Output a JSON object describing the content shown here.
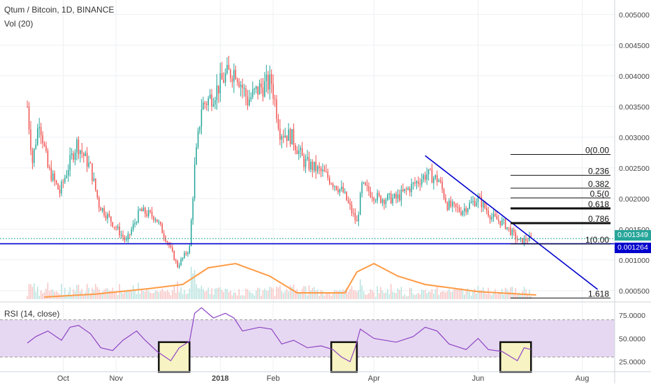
{
  "header": {
    "title": "Qtum / Bitcoin, 1D, BINANCE",
    "volume_label": "Vol (20)",
    "rsi_label": "RSI (14, close)"
  },
  "colors": {
    "up": "#26a69a",
    "down": "#ef5350",
    "line": "#0000cc",
    "volume_ma": "#ff9b45",
    "rsi": "#8e44c4",
    "rsi_band": "#e6d8f2",
    "price_tag_green": "#26a69a",
    "price_tag_blue": "#0000cc",
    "highlight_fill": "#f7f3c2"
  },
  "price_tags": {
    "current": "0.001349",
    "support": "0.001264"
  },
  "chart_data": [
    {
      "type": "candlestick",
      "title": "Qtum / Bitcoin, 1D, BINANCE",
      "x_ticks": [
        "Oct",
        "Nov",
        "2018",
        "Feb",
        "Apr",
        "Jun",
        "Aug"
      ],
      "y_ticks": [
        "0.000500",
        "0.001000",
        "0.001500",
        "0.002000",
        "0.002500",
        "0.003000",
        "0.003500",
        "0.004000",
        "0.004500",
        "0.005000"
      ],
      "ylim": [
        0.00035,
        0.0051
      ],
      "close_path": [
        [
          "2017-09-10",
          0.0035
        ],
        [
          "2017-09-13",
          0.0026
        ],
        [
          "2017-09-17",
          0.0033
        ],
        [
          "2017-09-22",
          0.0025
        ],
        [
          "2017-09-29",
          0.0021
        ],
        [
          "2017-10-05",
          0.0026
        ],
        [
          "2017-10-09",
          0.0029
        ],
        [
          "2017-10-17",
          0.0025
        ],
        [
          "2017-10-22",
          0.0019
        ],
        [
          "2017-10-30",
          0.0016
        ],
        [
          "2017-11-07",
          0.0013
        ],
        [
          "2017-11-15",
          0.0018
        ],
        [
          "2017-11-24",
          0.0017
        ],
        [
          "2017-12-01",
          0.0013
        ],
        [
          "2017-12-07",
          0.0009
        ],
        [
          "2017-12-14",
          0.0012
        ],
        [
          "2017-12-17",
          0.0025
        ],
        [
          "2017-12-21",
          0.0035
        ],
        [
          "2017-12-28",
          0.0037
        ],
        [
          "2018-01-04",
          0.004
        ],
        [
          "2018-01-10",
          0.0041
        ],
        [
          "2018-01-17",
          0.0036
        ],
        [
          "2018-01-24",
          0.0038
        ],
        [
          "2018-01-31",
          0.0039
        ],
        [
          "2018-02-05",
          0.0031
        ],
        [
          "2018-02-12",
          0.003
        ],
        [
          "2018-02-19",
          0.0026
        ],
        [
          "2018-03-03",
          0.0024
        ],
        [
          "2018-03-14",
          0.0021
        ],
        [
          "2018-03-22",
          0.0016
        ],
        [
          "2018-03-25",
          0.0022
        ],
        [
          "2018-04-04",
          0.002
        ],
        [
          "2018-04-14",
          0.002
        ],
        [
          "2018-04-23",
          0.0022
        ],
        [
          "2018-05-02",
          0.0024
        ],
        [
          "2018-05-09",
          0.0023
        ],
        [
          "2018-05-14",
          0.0019
        ],
        [
          "2018-05-22",
          0.0018
        ],
        [
          "2018-06-01",
          0.002
        ],
        [
          "2018-06-09",
          0.0017
        ],
        [
          "2018-06-16",
          0.0016
        ],
        [
          "2018-06-25",
          0.0013
        ],
        [
          "2018-07-02",
          0.00135
        ]
      ],
      "trend_line": {
        "from": [
          "2018-05-01",
          0.0027
        ],
        "to": [
          "2018-08-10",
          0.00052
        ]
      },
      "support_line": 0.001264,
      "fib_levels": [
        {
          "label": "0(0.00",
          "value": 0.00272
        },
        {
          "label": "0.236",
          "value": 0.00238
        },
        {
          "label": "0.382",
          "value": 0.00217
        },
        {
          "label": "0.5(0",
          "value": 0.00201
        },
        {
          "label": "0.618",
          "value": 0.00184
        },
        {
          "label": "0.786",
          "value": 0.0016
        },
        {
          "label": "1(0.00",
          "value": 0.00126
        },
        {
          "label": "1.618",
          "value": 0.00038
        }
      ]
    },
    {
      "type": "area",
      "title": "Vol (20)",
      "ma_path": [
        [
          "2017-09-20",
          0.05
        ],
        [
          "2017-10-20",
          0.12
        ],
        [
          "2017-11-20",
          0.25
        ],
        [
          "2017-12-10",
          0.35
        ],
        [
          "2017-12-25",
          0.75
        ],
        [
          "2018-01-10",
          0.85
        ],
        [
          "2018-01-30",
          0.55
        ],
        [
          "2018-02-15",
          0.15
        ],
        [
          "2018-03-15",
          0.15
        ],
        [
          "2018-03-22",
          0.65
        ],
        [
          "2018-04-01",
          0.85
        ],
        [
          "2018-04-15",
          0.55
        ],
        [
          "2018-05-01",
          0.35
        ],
        [
          "2018-06-01",
          0.18
        ],
        [
          "2018-07-05",
          0.1
        ]
      ]
    },
    {
      "type": "line",
      "title": "RSI (14, close)",
      "y_ticks": [
        "25.0000",
        "50.0000",
        "75.0000"
      ],
      "ylim": [
        15,
        87
      ],
      "bands": [
        30,
        70
      ],
      "series": [
        {
          "values": [
            [
              "2017-09-10",
              45
            ],
            [
              "2017-09-15",
              52
            ],
            [
              "2017-09-22",
              58
            ],
            [
              "2017-09-30",
              48
            ],
            [
              "2017-10-05",
              62
            ],
            [
              "2017-10-10",
              64
            ],
            [
              "2017-10-17",
              55
            ],
            [
              "2017-10-23",
              40
            ],
            [
              "2017-10-30",
              37
            ],
            [
              "2017-11-05",
              48
            ],
            [
              "2017-11-13",
              58
            ],
            [
              "2017-11-18",
              48
            ],
            [
              "2017-11-25",
              36
            ],
            [
              "2017-12-03",
              26
            ],
            [
              "2017-12-08",
              40
            ],
            [
              "2017-12-14",
              47
            ],
            [
              "2017-12-17",
              77
            ],
            [
              "2017-12-21",
              83
            ],
            [
              "2017-12-28",
              72
            ],
            [
              "2018-01-04",
              77
            ],
            [
              "2018-01-09",
              72
            ],
            [
              "2018-01-14",
              58
            ],
            [
              "2018-01-24",
              62
            ],
            [
              "2018-01-31",
              60
            ],
            [
              "2018-02-06",
              44
            ],
            [
              "2018-02-13",
              48
            ],
            [
              "2018-02-21",
              40
            ],
            [
              "2018-03-01",
              42
            ],
            [
              "2018-03-08",
              38
            ],
            [
              "2018-03-13",
              30
            ],
            [
              "2018-03-18",
              25
            ],
            [
              "2018-03-21",
              40
            ],
            [
              "2018-03-24",
              60
            ],
            [
              "2018-04-01",
              50
            ],
            [
              "2018-04-14",
              46
            ],
            [
              "2018-04-24",
              52
            ],
            [
              "2018-05-01",
              62
            ],
            [
              "2018-05-08",
              58
            ],
            [
              "2018-05-15",
              44
            ],
            [
              "2018-05-25",
              38
            ],
            [
              "2018-06-01",
              50
            ],
            [
              "2018-06-07",
              38
            ],
            [
              "2018-06-15",
              36
            ],
            [
              "2018-06-24",
              26
            ],
            [
              "2018-06-28",
              40
            ],
            [
              "2018-07-02",
              38
            ]
          ]
        }
      ],
      "highlights": [
        {
          "start": "2017-11-26",
          "end": "2017-12-14"
        },
        {
          "start": "2018-03-07",
          "end": "2018-03-22"
        },
        {
          "start": "2018-06-14",
          "end": "2018-07-02"
        }
      ]
    }
  ]
}
